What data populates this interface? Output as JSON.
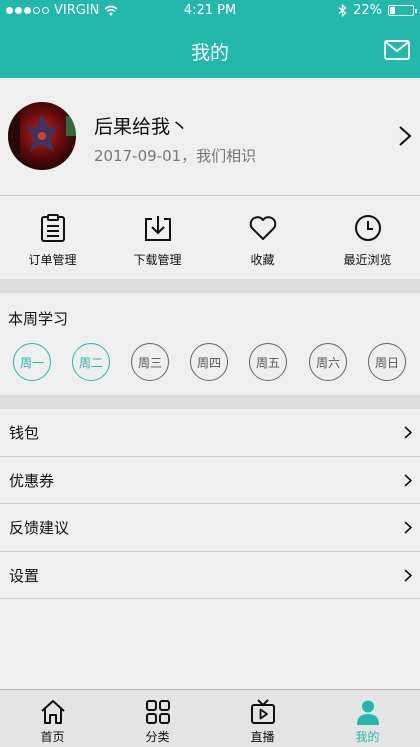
{
  "status_bar": {
    "carrier": "VIRGIN",
    "time": "4:21 PM",
    "battery": "22%",
    "battery_level": 0.22
  },
  "nav": {
    "title": "我的"
  },
  "profile": {
    "name": "后果给我丶",
    "date_text": "2017-09-01，我们相识"
  },
  "actions": [
    {
      "label": "订单管理",
      "icon": "clipboard-icon"
    },
    {
      "label": "下载管理",
      "icon": "download-icon"
    },
    {
      "label": "收藏",
      "icon": "heart-icon"
    },
    {
      "label": "最近浏览",
      "icon": "clock-icon"
    }
  ],
  "weekly": {
    "title": "本周学习",
    "days": [
      {
        "label": "周一",
        "done": true
      },
      {
        "label": "周二",
        "done": true
      },
      {
        "label": "周三",
        "done": false
      },
      {
        "label": "周四",
        "done": false
      },
      {
        "label": "周五",
        "done": false
      },
      {
        "label": "周六",
        "done": false
      },
      {
        "label": "周日",
        "done": false
      }
    ]
  },
  "menu": [
    {
      "label": "钱包"
    },
    {
      "label": "优惠券"
    },
    {
      "label": "反馈建议"
    },
    {
      "label": "设置"
    }
  ],
  "tabs": [
    {
      "label": "首页",
      "icon": "home-icon",
      "active": false
    },
    {
      "label": "分类",
      "icon": "grid-icon",
      "active": false
    },
    {
      "label": "直播",
      "icon": "tv-icon",
      "active": false
    },
    {
      "label": "我的",
      "icon": "user-icon",
      "active": true
    }
  ],
  "colors": {
    "accent": "#23b8ab",
    "background": "#efefef",
    "divider": "#dedede"
  }
}
